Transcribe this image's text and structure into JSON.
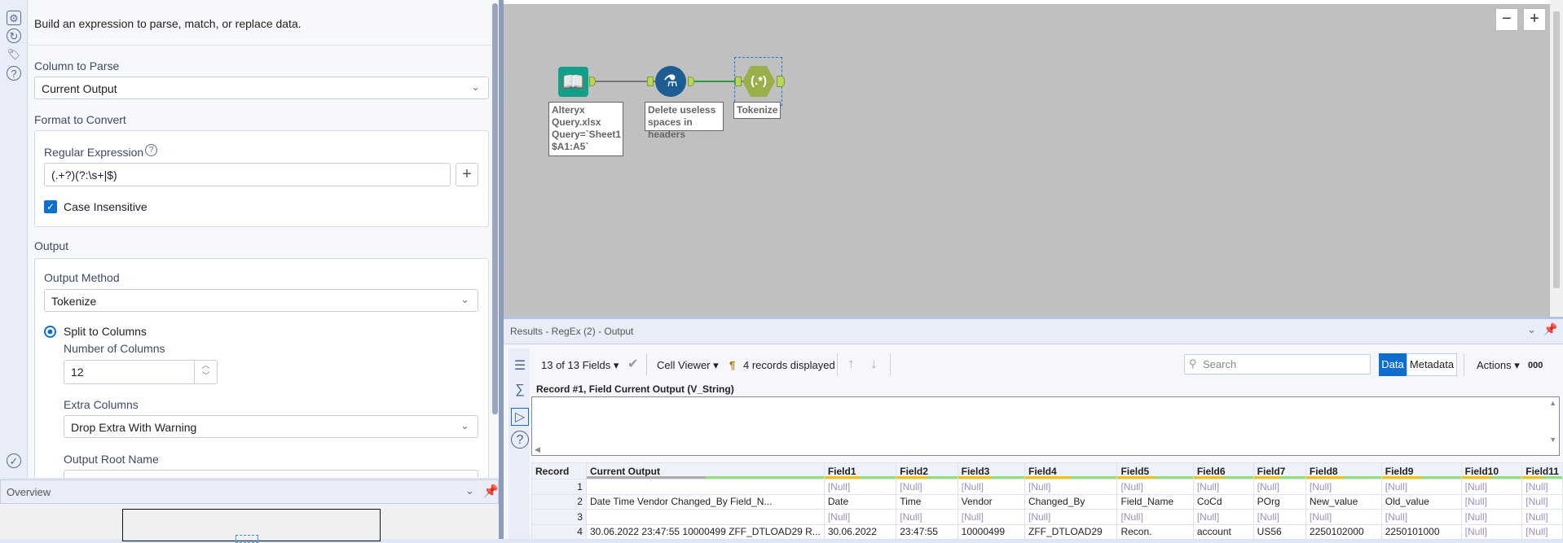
{
  "config": {
    "description": "Build an expression to parse, match, or replace data.",
    "column_to_parse_label": "Column to Parse",
    "column_to_parse_value": "Current Output",
    "format_label": "Format to Convert",
    "regex_label": "Regular Expression",
    "regex_value": "(.+?)(?:\\s+|$)",
    "case_insensitive_label": "Case Insensitive",
    "case_insensitive": true,
    "output_label": "Output",
    "output_method_label": "Output Method",
    "output_method_value": "Tokenize",
    "split_to_columns_label": "Split to Columns",
    "num_columns_label": "Number of Columns",
    "num_columns_value": "12",
    "extra_columns_label": "Extra Columns",
    "extra_columns_value": "Drop Extra With Warning",
    "output_root_label": "Output Root Name"
  },
  "overview": {
    "title": "Overview"
  },
  "canvas": {
    "nodes": [
      {
        "label": "Alteryx Query.xlsx Query=`Sheet1 $A1:A5`"
      },
      {
        "label": "Delete useless spaces in headers"
      },
      {
        "label": "Tokenize",
        "icon_text": "(.*)"
      }
    ],
    "zoom_out": "−",
    "zoom_in": "+"
  },
  "results": {
    "title": "Results - RegEx (2) - Output",
    "fields_selector": "13 of 13 Fields",
    "cell_viewer": "Cell Viewer",
    "records_displayed": "4 records displayed",
    "search_placeholder": "Search",
    "data_tab": "Data",
    "metadata_tab": "Metadata",
    "actions": "Actions",
    "more": "000",
    "record_field_label": "Record #1, Field Current Output (V_String)",
    "columns": [
      "Record",
      "Current Output",
      "Field1",
      "Field2",
      "Field3",
      "Field4",
      "Field5",
      "Field6",
      "Field7",
      "Field8",
      "Field9",
      "Field10",
      "Field11"
    ],
    "rows": [
      [
        "1",
        "",
        "[Null]",
        "[Null]",
        "[Null]",
        "[Null]",
        "[Null]",
        "[Null]",
        "[Null]",
        "[Null]",
        "[Null]",
        "[Null]",
        "[Null]"
      ],
      [
        "2",
        "Date      Time     Vendor     Changed_By   Field_N...",
        "Date",
        "Time",
        "Vendor",
        "Changed_By",
        "Field_Name",
        "CoCd",
        "POrg",
        "New_value",
        "Old_value",
        "[Null]",
        "[Null]"
      ],
      [
        "3",
        "",
        "[Null]",
        "[Null]",
        "[Null]",
        "[Null]",
        "[Null]",
        "[Null]",
        "[Null]",
        "[Null]",
        "[Null]",
        "[Null]",
        "[Null]"
      ],
      [
        "4",
        "30.06.2022 23:47:55 10000499   ZFF_DTLOAD29 R...",
        "30.06.2022",
        "23:47:55",
        "10000499",
        "ZFF_DTLOAD29",
        "Recon.",
        "account",
        "US56",
        "2250102000",
        "2250101000",
        "[Null]",
        "[Null]"
      ]
    ]
  },
  "colors": {
    "accent": "#0f6ecd",
    "node_input": "#12a08a",
    "node_formula": "#1e5d91",
    "node_regex": "#9aae4a"
  }
}
